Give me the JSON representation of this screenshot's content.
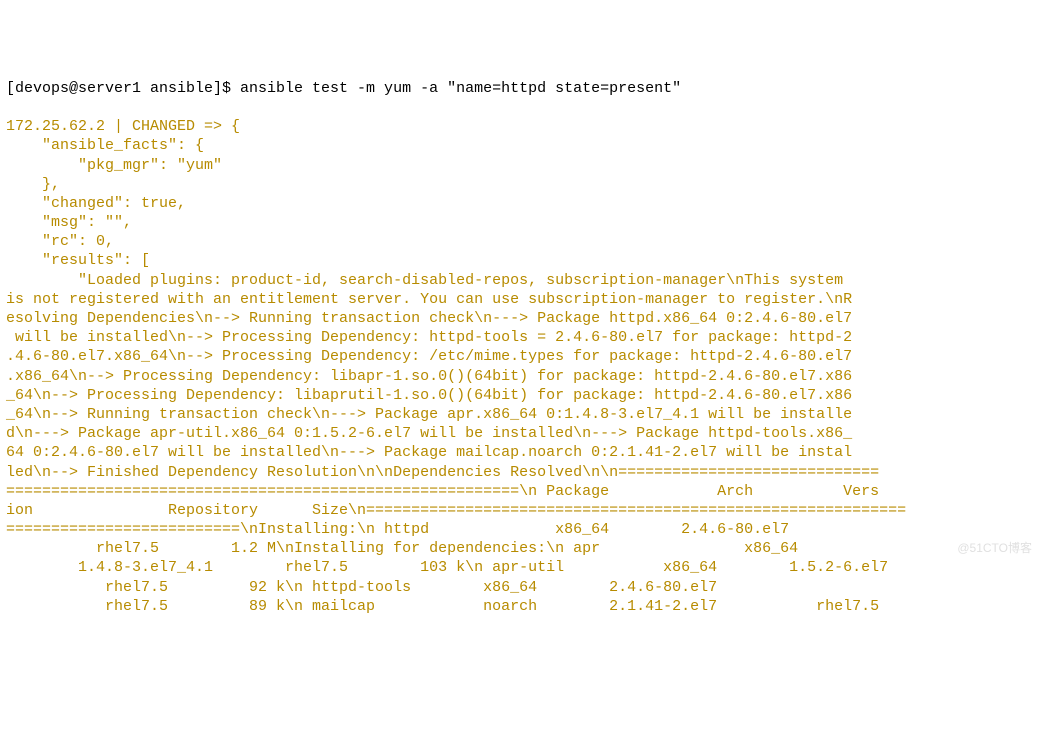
{
  "prompt_line": "[devops@server1 ansible]$ ansible test -m yum -a \"name=httpd state=present\"",
  "output_lines": [
    "172.25.62.2 | CHANGED => {",
    "    \"ansible_facts\": {",
    "        \"pkg_mgr\": \"yum\"",
    "    },",
    "    \"changed\": true,",
    "    \"msg\": \"\",",
    "    \"rc\": 0,",
    "    \"results\": [",
    "        \"Loaded plugins: product-id, search-disabled-repos, subscription-manager\\nThis system",
    "is not registered with an entitlement server. You can use subscription-manager to register.\\nR",
    "esolving Dependencies\\n--> Running transaction check\\n---> Package httpd.x86_64 0:2.4.6-80.el7",
    " will be installed\\n--> Processing Dependency: httpd-tools = 2.4.6-80.el7 for package: httpd-2",
    ".4.6-80.el7.x86_64\\n--> Processing Dependency: /etc/mime.types for package: httpd-2.4.6-80.el7",
    ".x86_64\\n--> Processing Dependency: libapr-1.so.0()(64bit) for package: httpd-2.4.6-80.el7.x86",
    "_64\\n--> Processing Dependency: libaprutil-1.so.0()(64bit) for package: httpd-2.4.6-80.el7.x86",
    "_64\\n--> Running transaction check\\n---> Package apr.x86_64 0:1.4.8-3.el7_4.1 will be installe",
    "d\\n---> Package apr-util.x86_64 0:1.5.2-6.el7 will be installed\\n---> Package httpd-tools.x86_",
    "64 0:2.4.6-80.el7 will be installed\\n---> Package mailcap.noarch 0:2.1.41-2.el7 will be instal",
    "led\\n--> Finished Dependency Resolution\\n\\nDependencies Resolved\\n\\n=============================",
    "=========================================================\\n Package            Arch          Vers",
    "ion               Repository      Size\\n============================================================",
    "==========================\\nInstalling:\\n httpd              x86_64        2.4.6-80.el7",
    "          rhel7.5        1.2 M\\nInstalling for dependencies:\\n apr                x86_64",
    "        1.4.8-3.el7_4.1        rhel7.5        103 k\\n apr-util           x86_64        1.5.2-6.el7",
    "           rhel7.5         92 k\\n httpd-tools        x86_64        2.4.6-80.el7",
    "           rhel7.5         89 k\\n mailcap            noarch        2.1.41-2.el7           rhel7.5"
  ],
  "watermark": "@51CTO博客"
}
